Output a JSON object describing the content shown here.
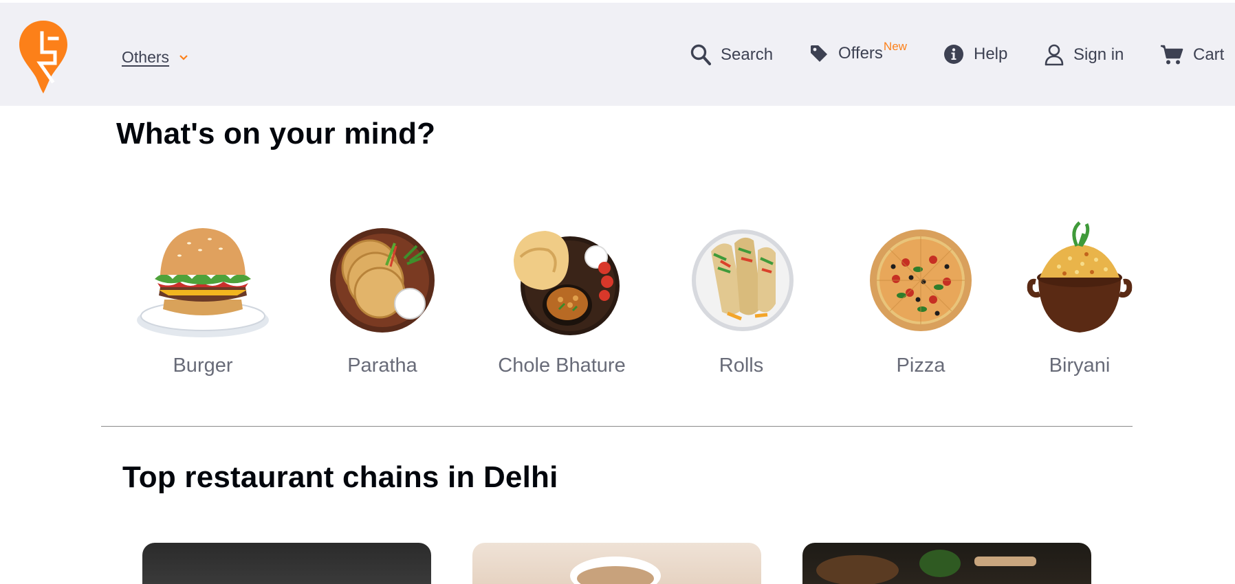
{
  "header": {
    "location_label": "Others",
    "nav": {
      "search": "Search",
      "offers": "Offers",
      "offers_badge": "New",
      "help": "Help",
      "sign_in": "Sign in",
      "cart": "Cart"
    }
  },
  "mind": {
    "title": "What's on your mind?",
    "items": [
      {
        "label": "Burger",
        "icon": "burger-image"
      },
      {
        "label": "Paratha",
        "icon": "paratha-image"
      },
      {
        "label": "Chole Bhature",
        "icon": "chole-bhature-image"
      },
      {
        "label": "Rolls",
        "icon": "rolls-image"
      },
      {
        "label": "Pizza",
        "icon": "pizza-image"
      },
      {
        "label": "Biryani",
        "icon": "biryani-image"
      }
    ]
  },
  "chains": {
    "title": "Top restaurant chains in Delhi"
  },
  "colors": {
    "brand": "#fc8019",
    "header_bg": "#f0f0f5",
    "nav_text": "#3d4152"
  }
}
